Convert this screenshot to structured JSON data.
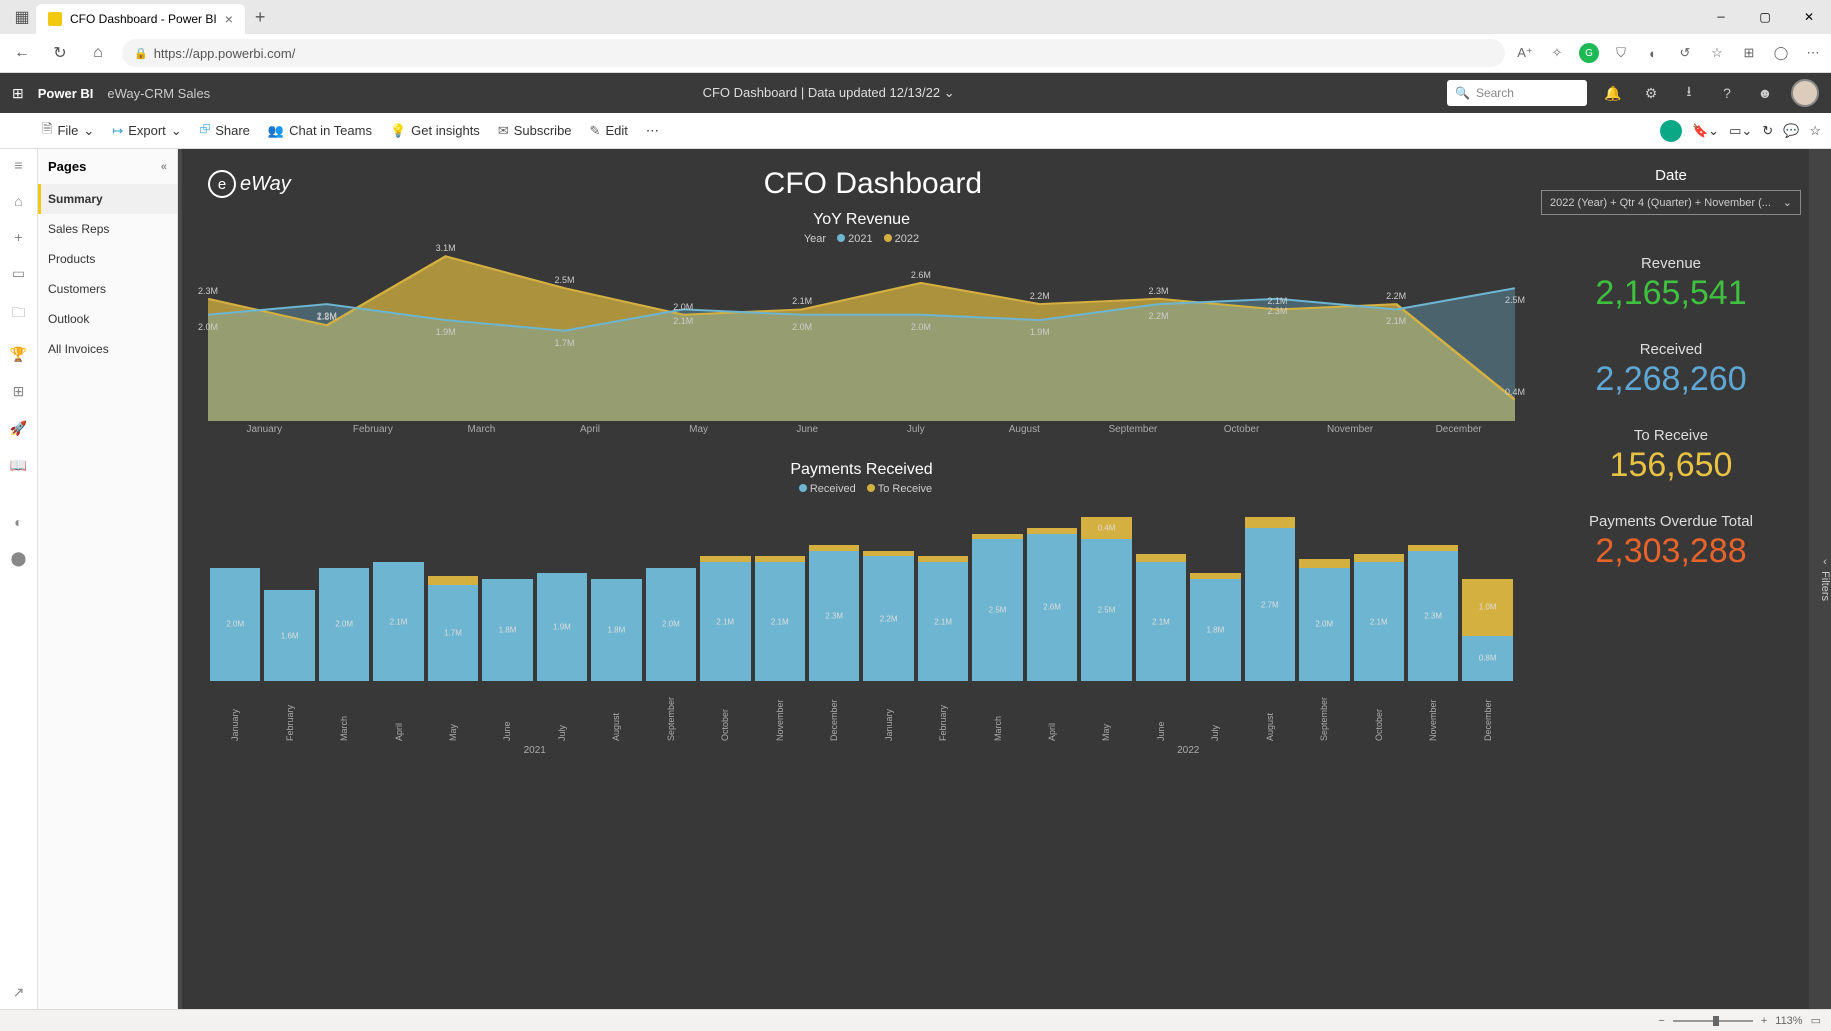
{
  "browser": {
    "tab_title": "CFO Dashboard - Power BI",
    "url": "https://app.powerbi.com/"
  },
  "app": {
    "name": "Power BI",
    "workspace": "eWay-CRM Sales",
    "center": "CFO Dashboard  |  Data updated 12/13/22",
    "search_placeholder": "Search"
  },
  "ribbon": {
    "file": "File",
    "export": "Export",
    "share": "Share",
    "chat": "Chat in Teams",
    "insights": "Get insights",
    "subscribe": "Subscribe",
    "edit": "Edit"
  },
  "pages": {
    "header": "Pages",
    "items": [
      "Summary",
      "Sales Reps",
      "Products",
      "Customers",
      "Outlook",
      "All Invoices"
    ],
    "active": 0
  },
  "dashboard": {
    "title": "CFO Dashboard",
    "logo_text": "eWay",
    "filters_label": "Filters",
    "date_label": "Date",
    "date_value": "2022 (Year) + Qtr 4 (Quarter) + November (...",
    "kpis": {
      "revenue": {
        "label": "Revenue",
        "value": "2,165,541"
      },
      "received": {
        "label": "Received",
        "value": "2,268,260"
      },
      "to_receive": {
        "label": "To Receive",
        "value": "156,650"
      },
      "overdue": {
        "label": "Payments Overdue Total",
        "value": "2,303,288"
      }
    }
  },
  "chart_data": [
    {
      "id": "yoy_revenue",
      "title": "YoY Revenue",
      "type": "area",
      "legend_prefix": "Year",
      "x_label": "",
      "categories": [
        "January",
        "February",
        "March",
        "April",
        "May",
        "June",
        "July",
        "August",
        "September",
        "October",
        "November",
        "December"
      ],
      "series": [
        {
          "name": "2021",
          "color": "#6db5d1",
          "values": [
            2.0,
            2.2,
            1.9,
            1.7,
            2.1,
            2.0,
            2.0,
            1.9,
            2.2,
            2.3,
            2.1,
            2.5
          ],
          "labels": [
            "2.0M",
            "2.2M",
            "1.9M",
            "1.7M",
            "2.1M",
            "2.0M",
            "2.0M",
            "1.9M",
            "2.2M",
            "2.3M",
            "2.1M",
            "2.5M"
          ]
        },
        {
          "name": "2022",
          "color": "#d4b040",
          "values": [
            2.3,
            1.8,
            3.1,
            2.5,
            2.0,
            2.1,
            2.6,
            2.2,
            2.3,
            2.1,
            2.2,
            0.4
          ],
          "labels": [
            "2.3M",
            "1.8M",
            "3.1M",
            "2.5M",
            "2.0M",
            "2.1M",
            "2.6M",
            "2.2M",
            "2.3M",
            "2.1M",
            "2.2M",
            "0.4M"
          ]
        }
      ],
      "ylim": [
        0,
        3.2
      ]
    },
    {
      "id": "payments_received",
      "title": "Payments Received",
      "type": "stacked-bar",
      "categories_years": [
        "2021",
        "2022"
      ],
      "categories": [
        "January",
        "February",
        "March",
        "April",
        "May",
        "June",
        "July",
        "August",
        "September",
        "October",
        "November",
        "December",
        "January",
        "February",
        "March",
        "April",
        "May",
        "June",
        "July",
        "August",
        "September",
        "October",
        "November",
        "December"
      ],
      "series": [
        {
          "name": "Received",
          "color": "#6db5d1",
          "values": [
            2.0,
            1.6,
            2.0,
            2.1,
            1.7,
            1.8,
            1.9,
            1.8,
            2.0,
            2.1,
            2.1,
            2.3,
            2.2,
            2.1,
            2.5,
            2.6,
            2.5,
            2.1,
            1.8,
            2.7,
            2.0,
            2.1,
            2.3,
            0.8
          ],
          "labels": [
            "2.0M",
            "1.6M",
            "2.0M",
            "2.1M",
            "1.7M",
            "1.8M",
            "1.9M",
            "1.8M",
            "2.0M",
            "2.1M",
            "2.1M",
            "2.3M",
            "2.2M",
            "2.1M",
            "2.5M",
            "2.6M",
            "2.5M",
            "2.1M",
            "1.8M",
            "2.7M",
            "2.0M",
            "2.1M",
            "2.3M",
            "0.8M"
          ]
        },
        {
          "name": "To Receive",
          "color": "#d4b040",
          "values": [
            0,
            0,
            0,
            0,
            0.15,
            0,
            0,
            0,
            0,
            0.1,
            0.1,
            0.1,
            0.1,
            0.1,
            0.1,
            0.1,
            0.4,
            0.15,
            0.1,
            0.2,
            0.15,
            0.15,
            0.1,
            1.0
          ],
          "labels": [
            "",
            "",
            "",
            "",
            "",
            "",
            "",
            "",
            "",
            "",
            "",
            "",
            "",
            "",
            "",
            "",
            "0.4M",
            "",
            "",
            "",
            "",
            "",
            "",
            "1.0M"
          ]
        }
      ],
      "ylim": [
        0,
        3.0
      ]
    }
  ],
  "status": {
    "zoom": "113%"
  }
}
